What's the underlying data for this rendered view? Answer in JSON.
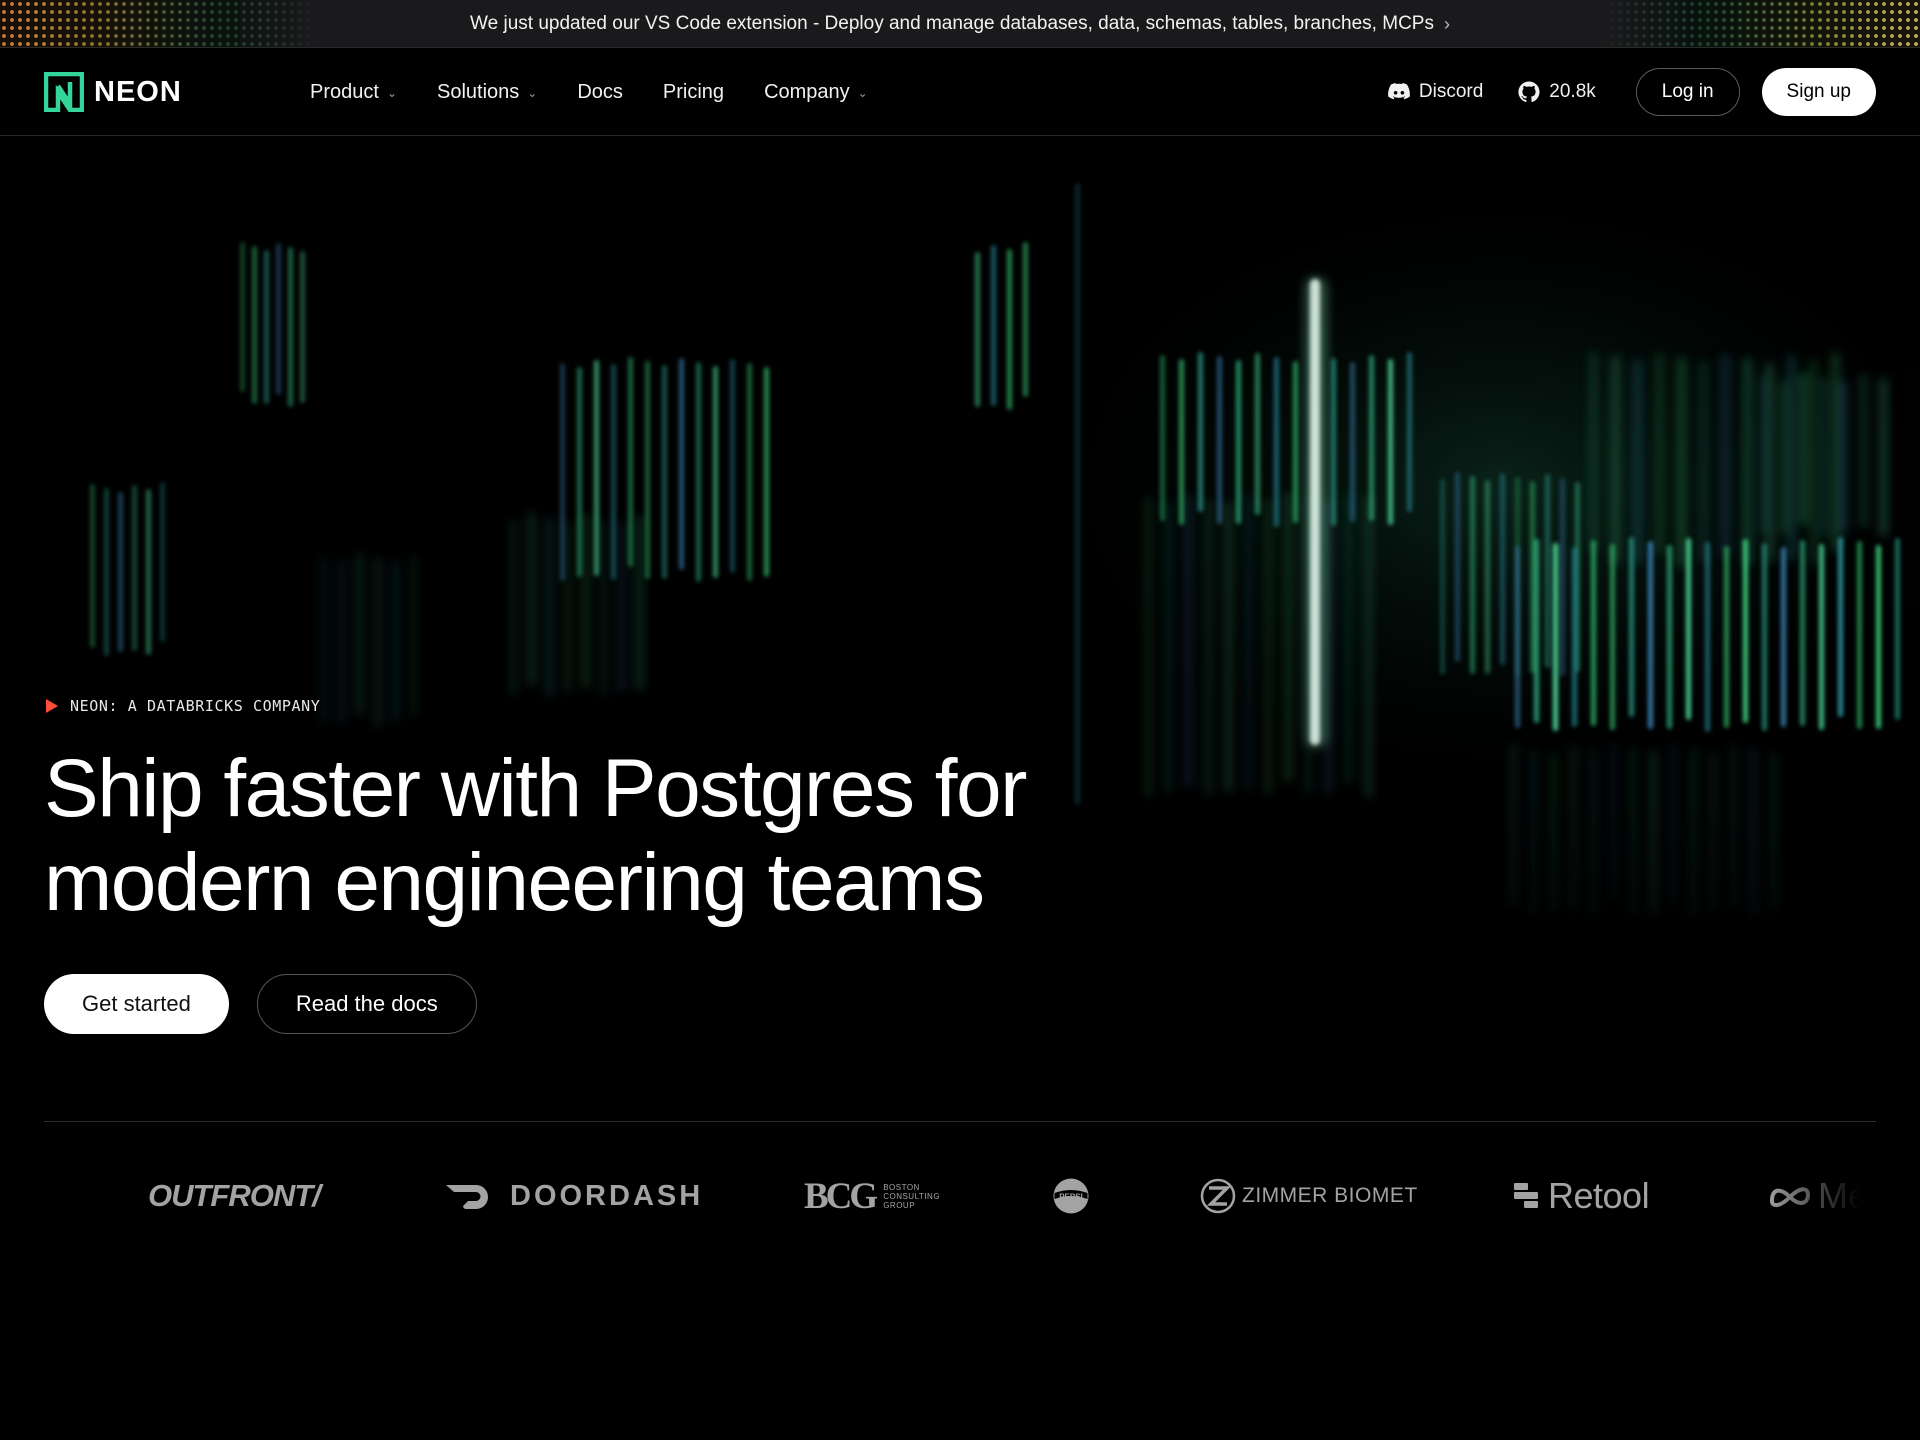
{
  "announcement": {
    "text": "We just updated our VS Code extension - Deploy and manage databases, data, schemas, tables, branches, MCPs",
    "chevron": "›"
  },
  "nav": {
    "logo_text": "NEON",
    "menu": [
      {
        "label": "Product",
        "has_dropdown": true
      },
      {
        "label": "Solutions",
        "has_dropdown": true
      },
      {
        "label": "Docs",
        "has_dropdown": false
      },
      {
        "label": "Pricing",
        "has_dropdown": false
      },
      {
        "label": "Company",
        "has_dropdown": true
      }
    ],
    "discord_label": "Discord",
    "github_stars": "20.8k",
    "login_label": "Log in",
    "signup_label": "Sign up"
  },
  "hero": {
    "eyebrow": "NEON: A DATABRICKS COMPANY",
    "headline_line1": "Ship faster with Postgres for",
    "headline_line2": "modern engineering teams",
    "primary_cta": "Get started",
    "secondary_cta": "Read the docs"
  },
  "customers": {
    "logos": [
      {
        "name": "OUTFRONT/"
      },
      {
        "name": "DOORDASH"
      },
      {
        "name": "BCG",
        "subtitle": [
          "BOSTON",
          "CONSULTING",
          "GROUP"
        ]
      },
      {
        "name": "PEPSI"
      },
      {
        "name": "ZIMMER BIOMET"
      },
      {
        "name": "Retool"
      },
      {
        "name": "Me"
      }
    ]
  },
  "colors": {
    "background": "#000000",
    "brand_green": "#34d59a",
    "eyebrow_marker": "#ff4c3b",
    "logo_gray": "#a3a3a3"
  }
}
